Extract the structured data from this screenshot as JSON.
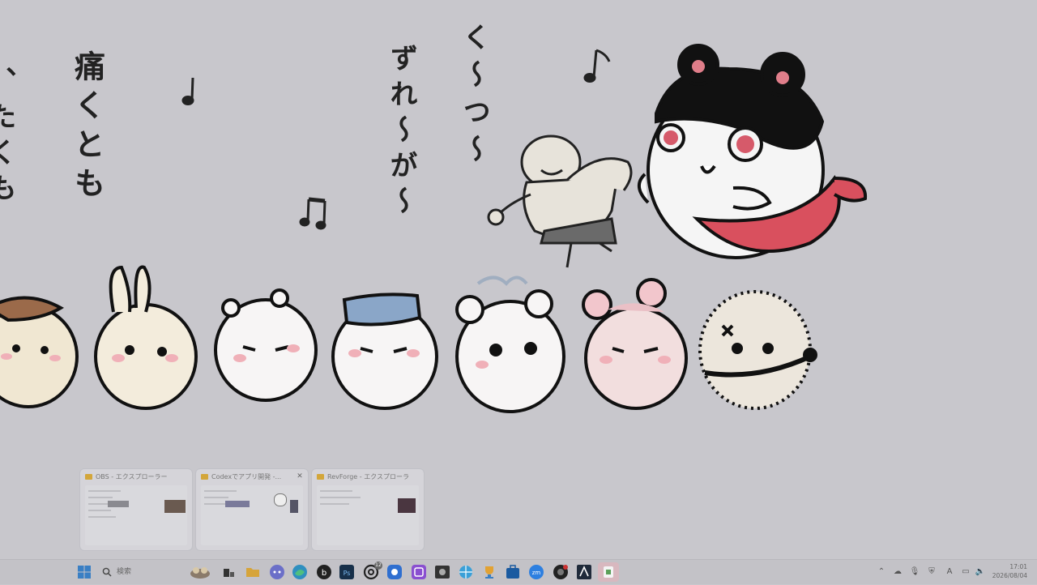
{
  "wallpaper": {
    "texts": {
      "left_column": "痛くとも",
      "far_left": "、たくも",
      "center_column1": "く〜つ〜",
      "center_column2": "ずれ〜が〜"
    }
  },
  "task_view": {
    "windows": [
      {
        "title": "OBS - エクスプローラー",
        "close": ""
      },
      {
        "title": "Codexでアプリ開発 -...",
        "close": "✕"
      },
      {
        "title": "RevForge - エクスプローラー",
        "close": ""
      }
    ]
  },
  "taskbar": {
    "search_placeholder": "検索",
    "badges": {
      "discord": "",
      "chatgpt": "12"
    },
    "clock": {
      "time": "17:01",
      "date": "2026/08/04"
    }
  }
}
